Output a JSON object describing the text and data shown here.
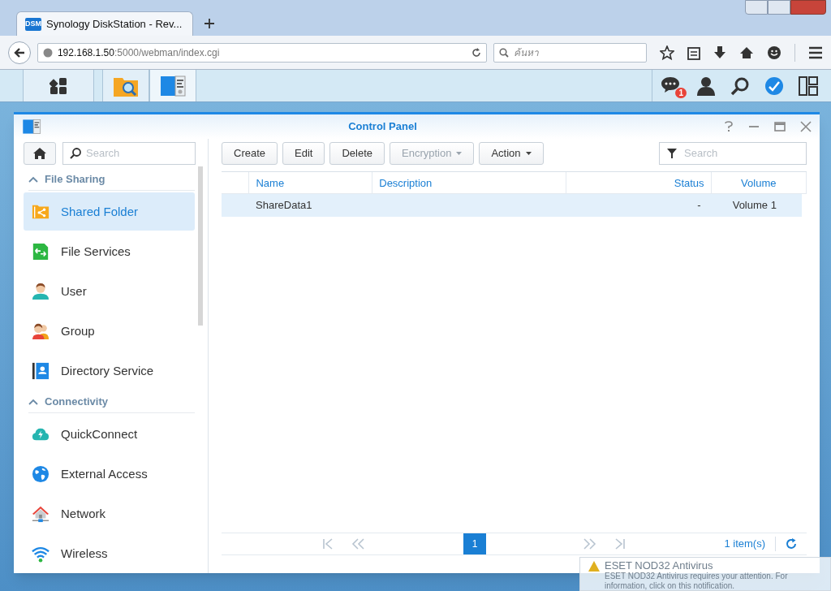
{
  "browser": {
    "tab_title": "Synology DiskStation - Rev...",
    "tab_badge": "DSM",
    "url_host": "192.168.1.50",
    "url_rest": ":5000/webman/index.cgi",
    "search_placeholder": "ค้นหา"
  },
  "dsm_taskbar": {
    "notification_count": "1"
  },
  "window": {
    "title": "Control Panel"
  },
  "sidebar": {
    "search_placeholder": "Search",
    "sections": [
      {
        "title": "File Sharing",
        "expanded": true,
        "items": [
          {
            "label": "Shared Folder",
            "selected": true
          },
          {
            "label": "File Services",
            "selected": false
          },
          {
            "label": "User",
            "selected": false
          },
          {
            "label": "Group",
            "selected": false
          },
          {
            "label": "Directory Service",
            "selected": false
          }
        ]
      },
      {
        "title": "Connectivity",
        "expanded": true,
        "items": [
          {
            "label": "QuickConnect",
            "selected": false
          },
          {
            "label": "External Access",
            "selected": false
          },
          {
            "label": "Network",
            "selected": false
          },
          {
            "label": "Wireless",
            "selected": false
          }
        ]
      }
    ]
  },
  "toolbar": {
    "buttons": [
      {
        "label": "Create",
        "dropdown": false,
        "disabled": false
      },
      {
        "label": "Edit",
        "dropdown": false,
        "disabled": false
      },
      {
        "label": "Delete",
        "dropdown": false,
        "disabled": false
      },
      {
        "label": "Encryption",
        "dropdown": true,
        "disabled": true
      },
      {
        "label": "Action",
        "dropdown": true,
        "disabled": false
      }
    ],
    "filter_placeholder": "Search"
  },
  "table": {
    "columns": [
      "Name",
      "Description",
      "Status",
      "Volume"
    ],
    "rows": [
      {
        "cells": [
          "ShareData1",
          "",
          "-",
          "Volume 1"
        ],
        "selected": true
      }
    ]
  },
  "pager": {
    "page": "1",
    "count": "1 item(s)"
  },
  "toast": {
    "title": "ESET NOD32 Antivirus",
    "lines": [
      "ESET NOD32 Antivirus requires your attention. For",
      "information, click on this notification."
    ]
  }
}
